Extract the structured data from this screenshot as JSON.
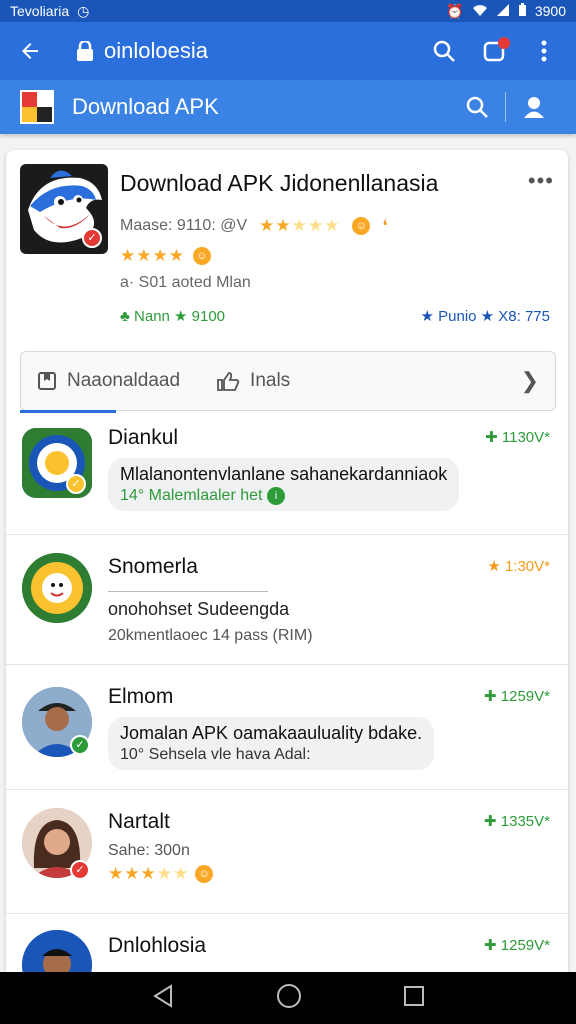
{
  "status_bar": {
    "carrier": "Tevoliaria",
    "battery": "3900"
  },
  "browser": {
    "url": "oinloloesia"
  },
  "site": {
    "title": "Download APK"
  },
  "app": {
    "title": "Download APK  Jidonenllanasia",
    "meta": "Maase: 9110: @V",
    "sub": "a· S01 aoted Mlan",
    "tag_left": "Nann ★ 9100",
    "tag_right": "★ Punio ★ X8: 775",
    "rating_main": 4,
    "rating_meta": 2.5
  },
  "tabs": [
    {
      "label": "Naaonaldaad"
    },
    {
      "label": "Inals"
    }
  ],
  "list": [
    {
      "name": "Diankul",
      "count": "1130V*",
      "count_color": "#2e9b3a",
      "line1": "Mlalanontenvlanlane sahanekardanniaok",
      "line2": "14° Malemlaaler het",
      "style": "bubble"
    },
    {
      "name": "Snomerla",
      "count": "1:30V*",
      "count_color": "#f29a1b",
      "line1": "onohohset Sudeengda",
      "line2": "20kmentlaoec 14 pass (RIM)",
      "style": "plain"
    },
    {
      "name": "Elmom",
      "count": "1259V*",
      "count_color": "#2e9b3a",
      "line1": "Jomalan APK oamakaauluality bdake.",
      "line2": "10° Sehsela vle hava Adal:",
      "style": "bubble"
    },
    {
      "name": "Nartalt",
      "count": "1335V*",
      "count_color": "#2e9b3a",
      "line1": "",
      "line2": "Sahe: 300n",
      "style": "rating",
      "rating": 3.5
    },
    {
      "name": "Dnlohlosia",
      "count": "1259V*",
      "count_color": "#2e9b3a",
      "line1": "",
      "line2": "",
      "style": "plain"
    }
  ],
  "colors": {
    "primary": "#2a6fdb",
    "green": "#2e9b3a",
    "star": "#f9a825"
  }
}
